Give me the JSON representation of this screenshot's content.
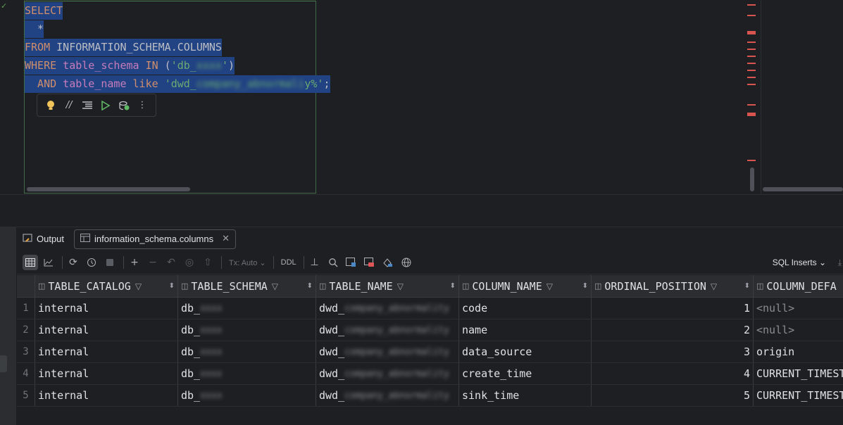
{
  "editor": {
    "lines": [
      {
        "parts": [
          {
            "t": "SELECT",
            "c": "kw"
          }
        ]
      },
      {
        "parts": [
          {
            "t": "  *",
            "c": "plain"
          }
        ]
      },
      {
        "parts": [
          {
            "t": "FROM",
            "c": "kw"
          },
          {
            "t": " INFORMATION_SCHEMA.COLUMNS",
            "c": "plain"
          }
        ]
      },
      {
        "parts": [
          {
            "t": "WHERE",
            "c": "kw"
          },
          {
            "t": " table_schema ",
            "c": "ident"
          },
          {
            "t": "IN",
            "c": "kw"
          },
          {
            "t": " (",
            "c": "plain"
          },
          {
            "t": "'db_",
            "c": "str"
          },
          {
            "t": "xxxx",
            "c": "str blur"
          },
          {
            "t": "'",
            "c": "str"
          },
          {
            "t": ")",
            "c": "plain"
          }
        ]
      },
      {
        "parts": [
          {
            "t": "  AND",
            "c": "kw"
          },
          {
            "t": " table_name ",
            "c": "ident"
          },
          {
            "t": "like",
            "c": "kw"
          },
          {
            "t": " ",
            "c": "plain"
          },
          {
            "t": "'dwd_",
            "c": "str"
          },
          {
            "t": "company_abnormali",
            "c": "str blur"
          },
          {
            "t": "y%'",
            "c": "str"
          },
          {
            "t": ";",
            "c": "plain"
          }
        ]
      }
    ],
    "code_toolbar_icons": [
      "lightbulb-icon",
      "comment-icon",
      "format-icon",
      "run-icon",
      "explain-icon",
      "more-icon"
    ]
  },
  "results": {
    "tabs": [
      {
        "label": "Output",
        "icon": "output-icon"
      },
      {
        "label": "information_schema.columns",
        "icon": "table-icon",
        "closable": true
      }
    ],
    "toolbar": {
      "tx_mode": "Tx: Auto",
      "ddl_label": "DDL",
      "export_format": "SQL Inserts"
    },
    "columns": [
      "TABLE_CATALOG",
      "TABLE_SCHEMA",
      "TABLE_NAME",
      "COLUMN_NAME",
      "ORDINAL_POSITION",
      "COLUMN_DEFA"
    ],
    "rows": [
      {
        "n": "1",
        "catalog": "internal",
        "schema": "db_",
        "schema_blur": "xxxx",
        "table": "dwd_",
        "table_blur": "company_abnormality",
        "column": "code",
        "pos": "1",
        "default": "<null>"
      },
      {
        "n": "2",
        "catalog": "internal",
        "schema": "db_",
        "schema_blur": "xxxx",
        "table": "dwd_",
        "table_blur": "company_abnormality",
        "column": "name",
        "pos": "2",
        "default": "<null>"
      },
      {
        "n": "3",
        "catalog": "internal",
        "schema": "db_",
        "schema_blur": "xxxx",
        "table": "dwd_",
        "table_blur": "company_abnormality",
        "column": "data_source",
        "pos": "3",
        "default": "origin"
      },
      {
        "n": "4",
        "catalog": "internal",
        "schema": "db_",
        "schema_blur": "xxxx",
        "table": "dwd_",
        "table_blur": "company_abnormality",
        "column": "create_time",
        "pos": "4",
        "default": "CURRENT_TIMEST"
      },
      {
        "n": "5",
        "catalog": "internal",
        "schema": "db_",
        "schema_blur": "xxxx",
        "table": "dwd_",
        "table_blur": "company_abnormality",
        "column": "sink_time",
        "pos": "5",
        "default": "CURRENT_TIMEST"
      }
    ]
  }
}
